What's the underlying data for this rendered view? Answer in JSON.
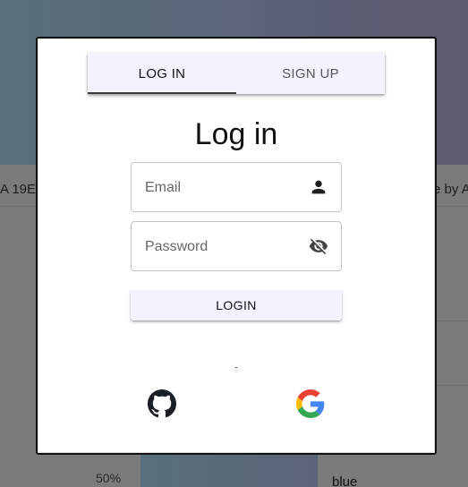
{
  "background": {
    "left_text": "A 19E",
    "right_text": "e by A",
    "percent_label": "50%",
    "color_label": "blue"
  },
  "dialog": {
    "tabs": [
      {
        "label": "LOG IN",
        "active": true
      },
      {
        "label": "SIGN UP",
        "active": false
      }
    ],
    "title": "Log in",
    "email": {
      "placeholder": "Email",
      "value": "",
      "icon": "person-icon"
    },
    "password": {
      "placeholder": "Password",
      "value": "",
      "icon": "visibility-off-icon"
    },
    "login_button": "LOGIN",
    "social": [
      {
        "name": "github",
        "icon": "github-icon"
      },
      {
        "name": "google",
        "icon": "google-icon"
      }
    ]
  }
}
